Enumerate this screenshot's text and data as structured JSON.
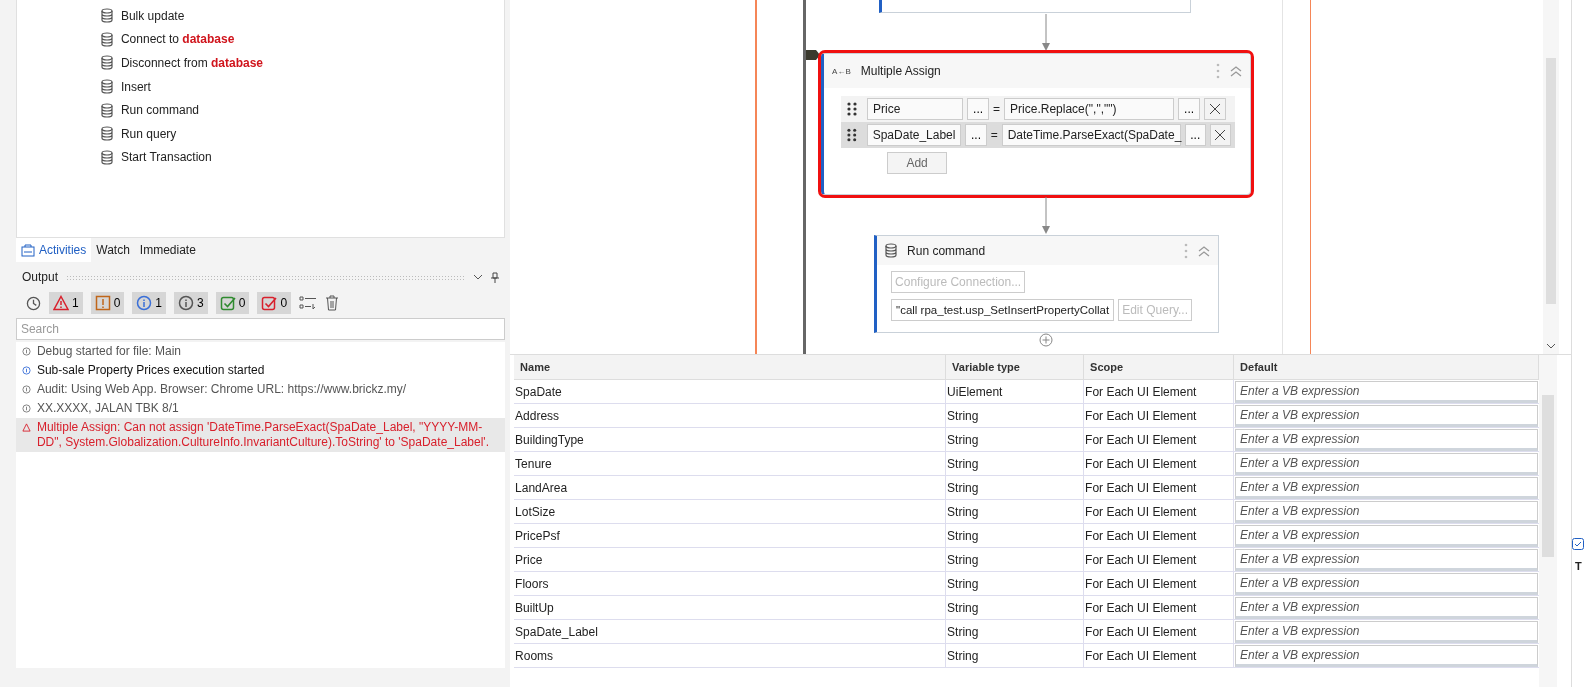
{
  "activities": [
    {
      "label": "Bulk update"
    },
    {
      "label": "Connect to **database**"
    },
    {
      "label": "Disconnect from **database**"
    },
    {
      "label": "Insert"
    },
    {
      "label": "Run command"
    },
    {
      "label": "Run query"
    },
    {
      "label": "Start Transaction"
    }
  ],
  "panel_tabs": [
    {
      "label": "Activities",
      "selected": true
    },
    {
      "label": "Watch",
      "selected": false
    },
    {
      "label": "Immediate",
      "selected": false
    }
  ],
  "output": {
    "title": "Output",
    "filters": [
      {
        "kind": "error",
        "count": "1"
      },
      {
        "kind": "warning",
        "count": "0"
      },
      {
        "kind": "info",
        "count": "1"
      },
      {
        "kind": "trace",
        "count": "3"
      },
      {
        "kind": "success",
        "count": "0"
      },
      {
        "kind": "failure",
        "count": "0"
      }
    ],
    "search": {
      "placeholder": "Search"
    },
    "log": [
      {
        "kind": "trace",
        "text": "Debug started for file: Main",
        "selected": false
      },
      {
        "kind": "info",
        "text": "Sub-sale Property Prices execution started",
        "selected": false
      },
      {
        "kind": "trace",
        "text": "Audit: Using Web App. Browser: Chrome URL: https://www.brickz.my/",
        "selected": false
      },
      {
        "kind": "trace",
        "text": "XX.XXXX, JALAN TBK 8/1",
        "selected": false
      },
      {
        "kind": "error",
        "text": "Multiple Assign: Can not assign 'DateTime.ParseExact(SpaDate_Label, \"YYYY-MM-DD\", System.Globalization.CultureInfo.InvariantCulture).ToString' to 'SpaDate_Label'.",
        "selected": true
      }
    ]
  },
  "designer": {
    "assign": {
      "icon_text": "A←B",
      "title": "Multiple Assign",
      "selected": true,
      "rows": [
        {
          "to": "Price",
          "to_button": "...",
          "equals": "=",
          "value": "Price.Replace(\",\",\"\")",
          "value_button": "...",
          "selected": false
        },
        {
          "to": "SpaDate_Label",
          "to_button": "...",
          "equals": "=",
          "value": "DateTime.ParseExact(SpaDate_",
          "value_button": "...",
          "selected": true
        }
      ],
      "add": "Add"
    },
    "run_command": {
      "title": "Run command",
      "connection": "Configure Connection...",
      "command": "\"call rpa_test.usp_SetInsertPropertyCollat",
      "edit": "Edit Query..."
    }
  },
  "variables": {
    "columns": [
      "Name",
      "Variable type",
      "Scope",
      "Default"
    ],
    "rows": [
      {
        "name": "SpaDate",
        "type": "UiElement",
        "scope": "For Each UI Element",
        "placeholder": "Enter a VB expression"
      },
      {
        "name": "Address",
        "type": "String",
        "scope": "For Each UI Element",
        "placeholder": "Enter a VB expression"
      },
      {
        "name": "BuildingType",
        "type": "String",
        "scope": "For Each UI Element",
        "placeholder": "Enter a VB expression"
      },
      {
        "name": "Tenure",
        "type": "String",
        "scope": "For Each UI Element",
        "placeholder": "Enter a VB expression"
      },
      {
        "name": "LandArea",
        "type": "String",
        "scope": "For Each UI Element",
        "placeholder": "Enter a VB expression"
      },
      {
        "name": "LotSize",
        "type": "String",
        "scope": "For Each UI Element",
        "placeholder": "Enter a VB expression"
      },
      {
        "name": "PricePsf",
        "type": "String",
        "scope": "For Each UI Element",
        "placeholder": "Enter a VB expression"
      },
      {
        "name": "Price",
        "type": "String",
        "scope": "For Each UI Element",
        "placeholder": "Enter a VB expression"
      },
      {
        "name": "Floors",
        "type": "String",
        "scope": "For Each UI Element",
        "placeholder": "Enter a VB expression"
      },
      {
        "name": "BuiltUp",
        "type": "String",
        "scope": "For Each UI Element",
        "placeholder": "Enter a VB expression"
      },
      {
        "name": "SpaDate_Label",
        "type": "String",
        "scope": "For Each UI Element",
        "placeholder": "Enter a VB expression"
      },
      {
        "name": "Rooms",
        "type": "String",
        "scope": "For Each UI Element",
        "placeholder": "Enter a VB expression"
      }
    ]
  },
  "right_panel": {
    "label": "T"
  }
}
